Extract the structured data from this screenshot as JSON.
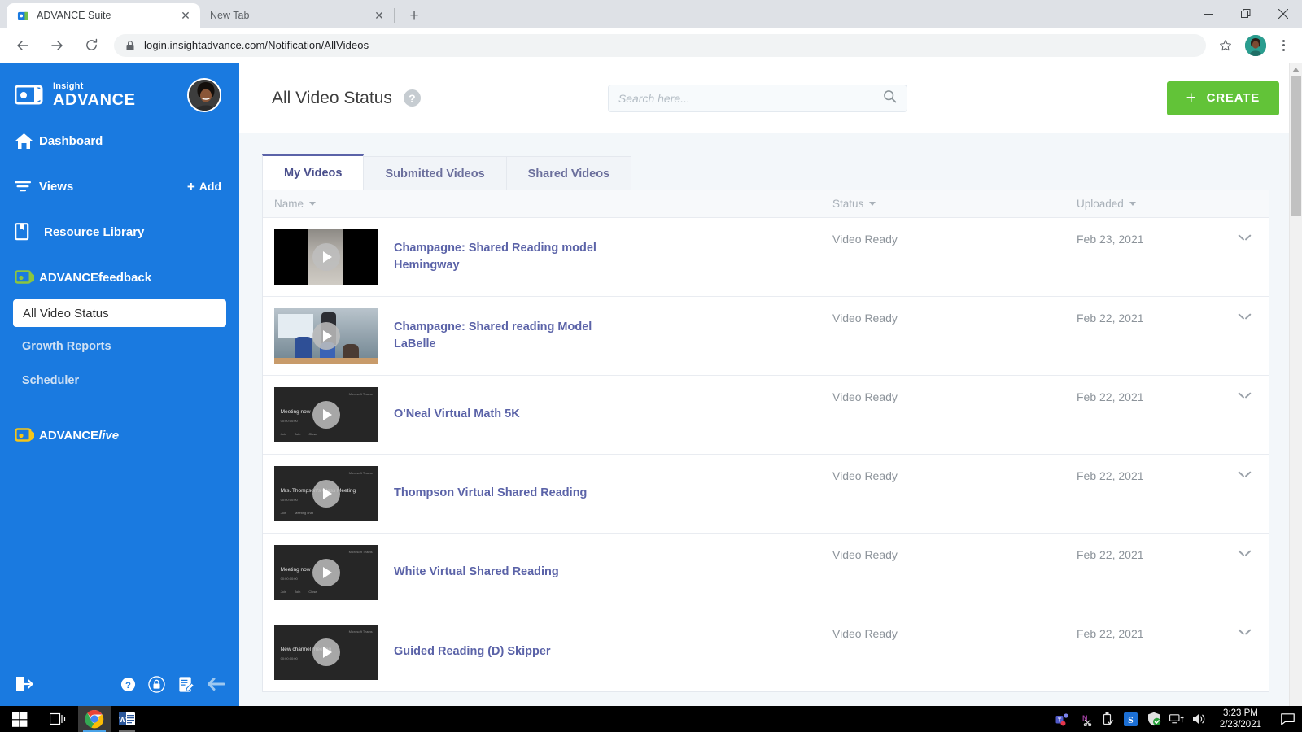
{
  "browser": {
    "tabs": [
      {
        "title": "ADVANCE Suite",
        "active": true,
        "favicon": "advance-logo-icon"
      },
      {
        "title": "New Tab",
        "active": false,
        "favicon": "none"
      }
    ],
    "newtab_label": "+",
    "url_secure": "login.insightadvance.com",
    "url_path": "/Notification/AllVideos",
    "url_full": "login.insightadvance.com/Notification/AllVideos",
    "window_controls": {
      "minimize": "minimize-icon",
      "maximize": "restore-icon",
      "close": "close-icon"
    }
  },
  "sidebar": {
    "logo": {
      "top": "Insight",
      "bottom": "ADVANCE"
    },
    "items": [
      {
        "label": "Dashboard",
        "icon": "home-icon"
      },
      {
        "label": "Views",
        "icon": "filter-icon",
        "action": "Add"
      },
      {
        "label": "Resource Library",
        "icon": "book-icon"
      },
      {
        "label": "ADVANCEfeedback",
        "icon": "video-green-icon"
      }
    ],
    "add_label": "Add",
    "subitems": [
      {
        "label": "All Video Status",
        "selected": true
      },
      {
        "label": "Growth Reports",
        "selected": false
      },
      {
        "label": "Scheduler",
        "selected": false
      }
    ],
    "advance_live": {
      "prefix": "ADVANCE",
      "suffix": "live",
      "icon": "video-yellow-icon"
    },
    "bottom_icons": [
      "logout-icon",
      "help-icon",
      "lock-icon",
      "notes-icon",
      "back-arrow-icon"
    ],
    "colors": {
      "bg": "#1a7ae0",
      "selected_bg": "#ffffff",
      "feedback_accent": "#8bc53f",
      "live_accent": "#f5c518"
    }
  },
  "header": {
    "title": "All Video Status",
    "help_glyph": "?",
    "search_placeholder": "Search here...",
    "search_value": "",
    "create_label": "CREATE",
    "create_plus": "+",
    "create_color": "#62c338"
  },
  "tabs": [
    {
      "label": "My Videos",
      "active": true
    },
    {
      "label": "Submitted Videos",
      "active": false
    },
    {
      "label": "Shared Videos",
      "active": false
    }
  ],
  "table": {
    "columns": [
      {
        "label": "Name",
        "sortable": true
      },
      {
        "label": "Status",
        "sortable": true
      },
      {
        "label": "Uploaded",
        "sortable": true
      }
    ],
    "rows": [
      {
        "name": "Champagne: Shared Reading model Hemingway",
        "status": "Video Ready",
        "uploaded": "Feb 23, 2021",
        "thumb_style": "black-hallway",
        "thumb_text": {
          "label": "",
          "sub": "",
          "corner": "",
          "foot": []
        }
      },
      {
        "name": "Champagne: Shared reading Model LaBelle",
        "status": "Video Ready",
        "uploaded": "Feb 22, 2021",
        "thumb_style": "classroom-photo",
        "thumb_text": {
          "label": "",
          "sub": "",
          "corner": "",
          "foot": []
        }
      },
      {
        "name": "O'Neal Virtual Math 5K",
        "status": "Video Ready",
        "uploaded": "Feb 22, 2021",
        "thumb_style": "teams-meeting",
        "thumb_text": {
          "label": "Meeting now",
          "sub": "00:00:00:00",
          "corner": "Microsoft Teams",
          "foot": [
            "Join",
            "Join",
            "Close"
          ]
        }
      },
      {
        "name": "Thompson Virtual Shared Reading",
        "status": "Video Ready",
        "uploaded": "Feb 22, 2021",
        "thumb_style": "teams-meeting",
        "thumb_text": {
          "label": "Mrs. Thompson's Class Meeting",
          "sub": "00:00:00:00",
          "corner": "Microsoft Teams",
          "foot": [
            "Join",
            "Meeting chat"
          ]
        }
      },
      {
        "name": "White Virtual Shared Reading",
        "status": "Video Ready",
        "uploaded": "Feb 22, 2021",
        "thumb_style": "teams-meeting",
        "thumb_text": {
          "label": "Meeting now",
          "sub": "00:00:00:00",
          "corner": "Microsoft Teams",
          "foot": [
            "Join",
            "Join",
            "Close"
          ]
        }
      },
      {
        "name": "Guided Reading (D) Skipper",
        "status": "Video Ready",
        "uploaded": "Feb 22, 2021",
        "thumb_style": "teams-meeting",
        "thumb_text": {
          "label": "New channel meeting",
          "sub": "00:00:00:00",
          "corner": "Microsoft Teams",
          "foot": []
        }
      }
    ]
  },
  "taskbar": {
    "start": "windows-start-icon",
    "taskview": "task-view-icon",
    "apps": [
      {
        "name": "chrome-icon",
        "active": true
      },
      {
        "name": "word-icon",
        "active": false
      }
    ],
    "tray_icons": [
      "teams-icon",
      "onenote-snip-icon",
      "usb-icon",
      "s-app-icon",
      "defender-shield-icon",
      "network-icon",
      "volume-icon"
    ],
    "time": "3:23 PM",
    "date": "2/23/2021",
    "notification": "notification-icon"
  }
}
